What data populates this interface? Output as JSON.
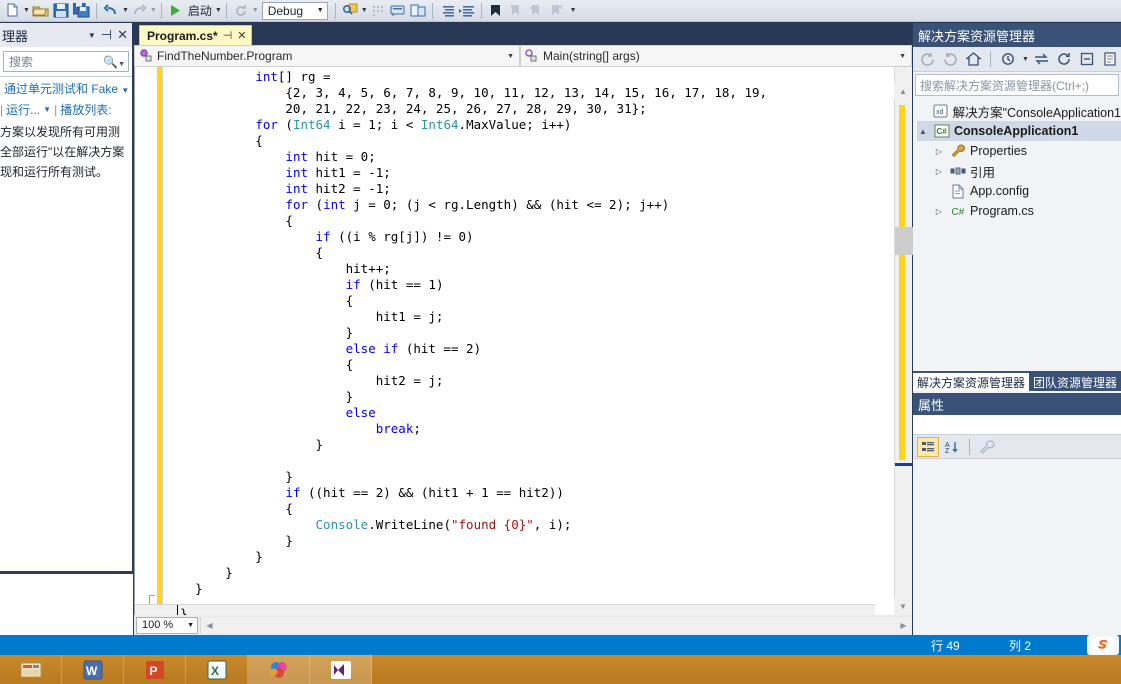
{
  "toolbar": {
    "buttons": [
      {
        "name": "new-file",
        "icon": "new-file-icon"
      },
      {
        "name": "open-file",
        "icon": "open-folder-icon"
      },
      {
        "name": "save",
        "icon": "save-icon"
      },
      {
        "name": "save-all",
        "icon": "save-all-icon"
      },
      {
        "name": "undo",
        "icon": "undo-icon"
      },
      {
        "name": "redo",
        "icon": "redo-icon"
      }
    ],
    "start_label": "启动",
    "debug_config": "Debug",
    "right_icons": [
      "find-icon",
      "snippet-icon",
      "comment-icon",
      "uncomment-icon",
      "indent-icon",
      "outdent-icon",
      "bookmark-icon",
      "nav-prev-icon",
      "nav-next-icon",
      "nav-clear-icon",
      "overflow-icon"
    ]
  },
  "left_panel": {
    "title": "理器",
    "search_placeholder": "搜索",
    "link_text": "通过单元测试和 Fake",
    "run_label": "运行...",
    "playlist_label": "播放列表:",
    "body_lines": [
      "方案以发现所有可用测",
      "全部运行\"以在解决方案",
      "现和运行所有测试。"
    ]
  },
  "editor": {
    "tab_label": "Program.cs*",
    "tab_pin": "⊣",
    "tab_close": "✕",
    "nav_left": "FindTheNumber.Program",
    "nav_right": "Main(string[] args)",
    "zoom_level": "100 %",
    "last_line": "}",
    "code_lines": [
      [
        {
          "t": "            ",
          "c": "pl"
        },
        {
          "t": "int",
          "c": "k"
        },
        {
          "t": "[] rg =",
          "c": "pl"
        }
      ],
      [
        {
          "t": "                {2, 3, 4, 5, 6, 7, 8, 9, 10, 11, 12, 13, 14, 15, 16, 17, 18, 19,",
          "c": "pl"
        }
      ],
      [
        {
          "t": "                20, 21, 22, 23, 24, 25, 26, 27, 28, 29, 30, 31};",
          "c": "pl"
        }
      ],
      [
        {
          "t": "            ",
          "c": "pl"
        },
        {
          "t": "for",
          "c": "k"
        },
        {
          "t": " (",
          "c": "pl"
        },
        {
          "t": "Int64",
          "c": "ty"
        },
        {
          "t": " i = 1; i < ",
          "c": "pl"
        },
        {
          "t": "Int64",
          "c": "ty"
        },
        {
          "t": ".MaxValue; i++)",
          "c": "pl"
        }
      ],
      [
        {
          "t": "            {",
          "c": "pl"
        }
      ],
      [
        {
          "t": "                ",
          "c": "pl"
        },
        {
          "t": "int",
          "c": "k"
        },
        {
          "t": " hit = 0;",
          "c": "pl"
        }
      ],
      [
        {
          "t": "                ",
          "c": "pl"
        },
        {
          "t": "int",
          "c": "k"
        },
        {
          "t": " hit1 = -1;",
          "c": "pl"
        }
      ],
      [
        {
          "t": "                ",
          "c": "pl"
        },
        {
          "t": "int",
          "c": "k"
        },
        {
          "t": " hit2 = -1;",
          "c": "pl"
        }
      ],
      [
        {
          "t": "                ",
          "c": "pl"
        },
        {
          "t": "for",
          "c": "k"
        },
        {
          "t": " (",
          "c": "pl"
        },
        {
          "t": "int",
          "c": "k"
        },
        {
          "t": " j = 0; (j < rg.Length) && (hit <= 2); j++)",
          "c": "pl"
        }
      ],
      [
        {
          "t": "                {",
          "c": "pl"
        }
      ],
      [
        {
          "t": "                    ",
          "c": "pl"
        },
        {
          "t": "if",
          "c": "k"
        },
        {
          "t": " ((i % rg[j]) != 0)",
          "c": "pl"
        }
      ],
      [
        {
          "t": "                    {",
          "c": "pl"
        }
      ],
      [
        {
          "t": "                        hit++;",
          "c": "pl"
        }
      ],
      [
        {
          "t": "                        ",
          "c": "pl"
        },
        {
          "t": "if",
          "c": "k"
        },
        {
          "t": " (hit == 1)",
          "c": "pl"
        }
      ],
      [
        {
          "t": "                        {",
          "c": "pl"
        }
      ],
      [
        {
          "t": "                            hit1 = j;",
          "c": "pl"
        }
      ],
      [
        {
          "t": "                        }",
          "c": "pl"
        }
      ],
      [
        {
          "t": "                        ",
          "c": "pl"
        },
        {
          "t": "else if",
          "c": "k"
        },
        {
          "t": " (hit == 2)",
          "c": "pl"
        }
      ],
      [
        {
          "t": "                        {",
          "c": "pl"
        }
      ],
      [
        {
          "t": "                            hit2 = j;",
          "c": "pl"
        }
      ],
      [
        {
          "t": "                        }",
          "c": "pl"
        }
      ],
      [
        {
          "t": "                        ",
          "c": "pl"
        },
        {
          "t": "else",
          "c": "k"
        }
      ],
      [
        {
          "t": "                            ",
          "c": "pl"
        },
        {
          "t": "break",
          "c": "k"
        },
        {
          "t": ";",
          "c": "pl"
        }
      ],
      [
        {
          "t": "                    }",
          "c": "pl"
        }
      ],
      [
        {
          "t": "",
          "c": "pl"
        }
      ],
      [
        {
          "t": "                }",
          "c": "pl"
        }
      ],
      [
        {
          "t": "                ",
          "c": "pl"
        },
        {
          "t": "if",
          "c": "k"
        },
        {
          "t": " ((hit == 2) && (hit1 + 1 == hit2))",
          "c": "pl"
        }
      ],
      [
        {
          "t": "                {",
          "c": "pl"
        }
      ],
      [
        {
          "t": "                    ",
          "c": "pl"
        },
        {
          "t": "Console",
          "c": "ty"
        },
        {
          "t": ".WriteLine(",
          "c": "pl"
        },
        {
          "t": "\"found {0}\"",
          "c": "st"
        },
        {
          "t": ", i);",
          "c": "pl"
        }
      ],
      [
        {
          "t": "                }",
          "c": "pl"
        }
      ],
      [
        {
          "t": "            }",
          "c": "pl"
        }
      ],
      [
        {
          "t": "        }",
          "c": "pl"
        }
      ],
      [
        {
          "t": "    }",
          "c": "pl"
        }
      ]
    ]
  },
  "solution_explorer": {
    "title": "解决方案资源管理器",
    "toolbar_icons": [
      "back-icon",
      "forward-icon",
      "home-icon",
      "pending-changes-icon",
      "sync-icon",
      "refresh-icon",
      "collapse-all-icon",
      "properties-icon"
    ],
    "search_placeholder": "搜索解决方案资源管理器(Ctrl+;)",
    "tree": [
      {
        "label": "解决方案\"ConsoleApplication1",
        "icon": "solution-icon",
        "indent": 0,
        "expander": "",
        "bold": false,
        "selected": false
      },
      {
        "label": "ConsoleApplication1",
        "icon": "csharp-project-icon",
        "indent": 0,
        "expander": "▲",
        "bold": true,
        "selected": true
      },
      {
        "label": "Properties",
        "icon": "wrench-icon",
        "indent": 1,
        "expander": "▷",
        "bold": false,
        "selected": false
      },
      {
        "label": "引用",
        "icon": "references-icon",
        "indent": 1,
        "expander": "▷",
        "bold": false,
        "selected": false
      },
      {
        "label": "App.config",
        "icon": "config-file-icon",
        "indent": 1,
        "expander": "",
        "bold": false,
        "selected": false
      },
      {
        "label": "Program.cs",
        "icon": "csharp-file-icon",
        "indent": 1,
        "expander": "▷",
        "bold": false,
        "selected": false
      }
    ],
    "tab_active": "解决方案资源管理器",
    "tab_inactive": "团队资源管理器"
  },
  "properties_panel": {
    "title": "属性",
    "tools": [
      "categorized-icon",
      "alphabetical-icon",
      "properties-wrench-icon"
    ]
  },
  "status_bar": {
    "message": "",
    "line_label": "行 49",
    "col_label": "列 2",
    "logo": "S"
  },
  "taskbar": {
    "items": [
      {
        "name": "file-explorer",
        "icon": "folder-icon",
        "active": false
      },
      {
        "name": "word",
        "icon": "word-icon",
        "active": false
      },
      {
        "name": "powerpoint",
        "icon": "powerpoint-icon",
        "active": false
      },
      {
        "name": "excel",
        "icon": "excel-icon",
        "active": false
      },
      {
        "name": "media-app",
        "icon": "colorwheel-icon",
        "active": true
      },
      {
        "name": "visual-studio",
        "icon": "vs-icon",
        "active": true
      }
    ]
  },
  "colors": {
    "accent": "#007acc",
    "panel_header": "#3a5178",
    "modified_margin": "#ffd21e",
    "tab_active": "#fef9c3",
    "keyword": "#0000ff",
    "type": "#2b91af",
    "string": "#a31515",
    "taskbar": "#c98a2e"
  }
}
